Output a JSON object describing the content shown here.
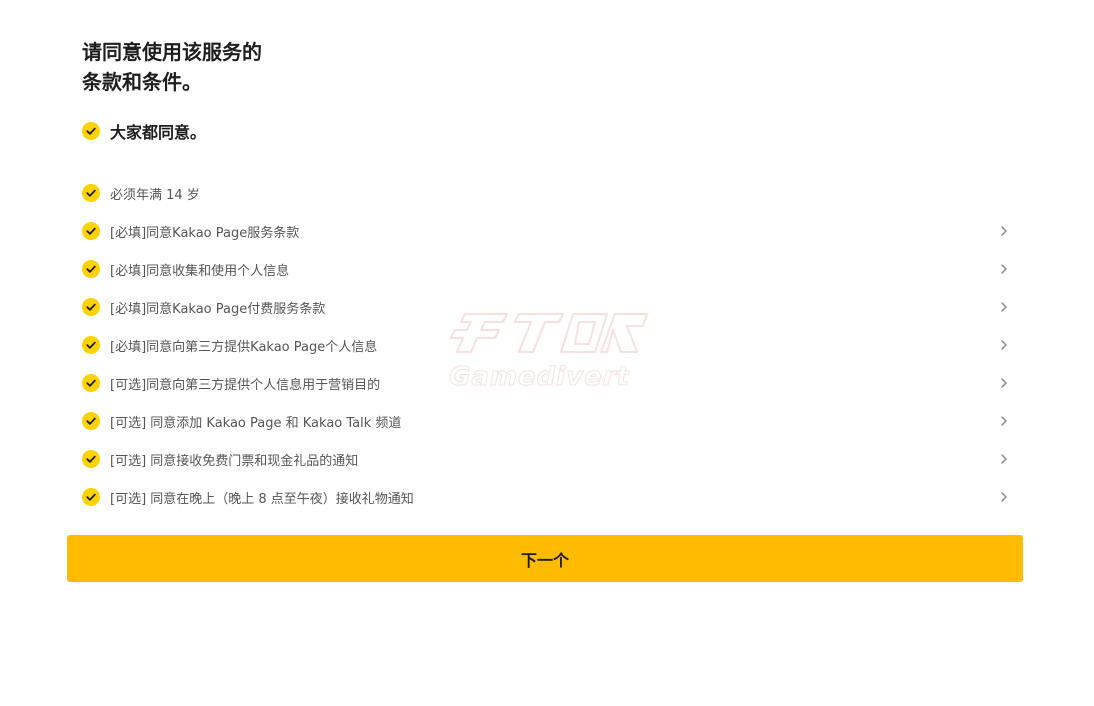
{
  "header": {
    "title_line1": "请同意使用该服务的",
    "title_line2": "条款和条件。"
  },
  "agree_all": {
    "label": "大家都同意。",
    "checked": true
  },
  "terms": [
    {
      "label": "必须年满 14 岁",
      "checked": true,
      "has_detail": false
    },
    {
      "label": "[必填]同意Kakao Page服务条款",
      "checked": true,
      "has_detail": true
    },
    {
      "label": "[必填]同意收集和使用个人信息",
      "checked": true,
      "has_detail": true
    },
    {
      "label": "[必填]同意Kakao Page付费服务条款",
      "checked": true,
      "has_detail": true
    },
    {
      "label": "[必填]同意向第三方提供Kakao Page个人信息",
      "checked": true,
      "has_detail": true
    },
    {
      "label": "[可选]同意向第三方提供个人信息用于营销目的",
      "checked": true,
      "has_detail": true
    },
    {
      "label": "[可选] 同意添加 Kakao Page 和 Kakao Talk 频道",
      "checked": true,
      "has_detail": true
    },
    {
      "label": "[可选] 同意接收免费门票和现金礼品的通知",
      "checked": true,
      "has_detail": true
    },
    {
      "label": "[可选] 同意在晚上（晚上 8 点至午夜）接收礼物通知",
      "checked": true,
      "has_detail": true
    }
  ],
  "watermark": {
    "text": "Gamedivert"
  },
  "footer": {
    "next_label": "下一个"
  },
  "colors": {
    "check_fill": "#ffd200",
    "button_bg": "#ffbb00",
    "text_primary": "#1e1e1e",
    "text_secondary": "#555555"
  },
  "icons": {
    "check": "check-icon",
    "chevron": "chevron-right-icon"
  }
}
